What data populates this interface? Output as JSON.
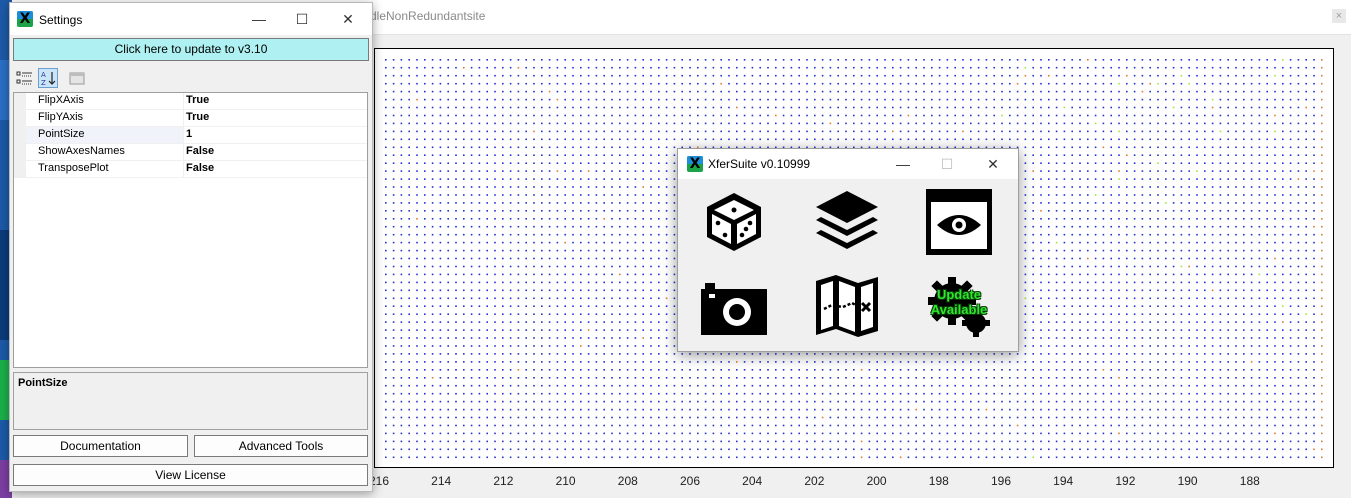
{
  "plot_window": {
    "title": "dleNonRedundantsite",
    "close_glyph": "×",
    "x_ticks": [
      "216",
      "214",
      "212",
      "210",
      "208",
      "206",
      "204",
      "202",
      "200",
      "198",
      "196",
      "194",
      "192",
      "190",
      "188"
    ]
  },
  "settings": {
    "title": "Settings",
    "update_label": "Click here to update to v3.10",
    "properties": [
      {
        "name": "FlipXAxis",
        "value": "True"
      },
      {
        "name": "FlipYAxis",
        "value": "True"
      },
      {
        "name": "PointSize",
        "value": "1"
      },
      {
        "name": "ShowAxesNames",
        "value": "False"
      },
      {
        "name": "TransposePlot",
        "value": "False"
      }
    ],
    "description_title": "PointSize",
    "documentation_label": "Documentation",
    "advanced_tools_label": "Advanced Tools",
    "view_license_label": "View License"
  },
  "xfersuite": {
    "title": "XferSuite v0.10999",
    "tools": [
      {
        "icon": "cube-icon"
      },
      {
        "icon": "layers-icon"
      },
      {
        "icon": "eye-window-icon"
      },
      {
        "icon": "camera-icon"
      },
      {
        "icon": "map-icon"
      },
      {
        "icon": "update-gear-icon"
      }
    ],
    "update_text_line1": "Update",
    "update_text_line2": "Available"
  },
  "window_controls": {
    "minimize": "—",
    "maximize": "☐",
    "close": "✕"
  },
  "colors": {
    "dot_blue": "#2233cc",
    "dot_orange": "#e07a30",
    "dot_green": "#9be83a",
    "update_bar": "#aff1f2",
    "update_text": "#2ee82e"
  }
}
